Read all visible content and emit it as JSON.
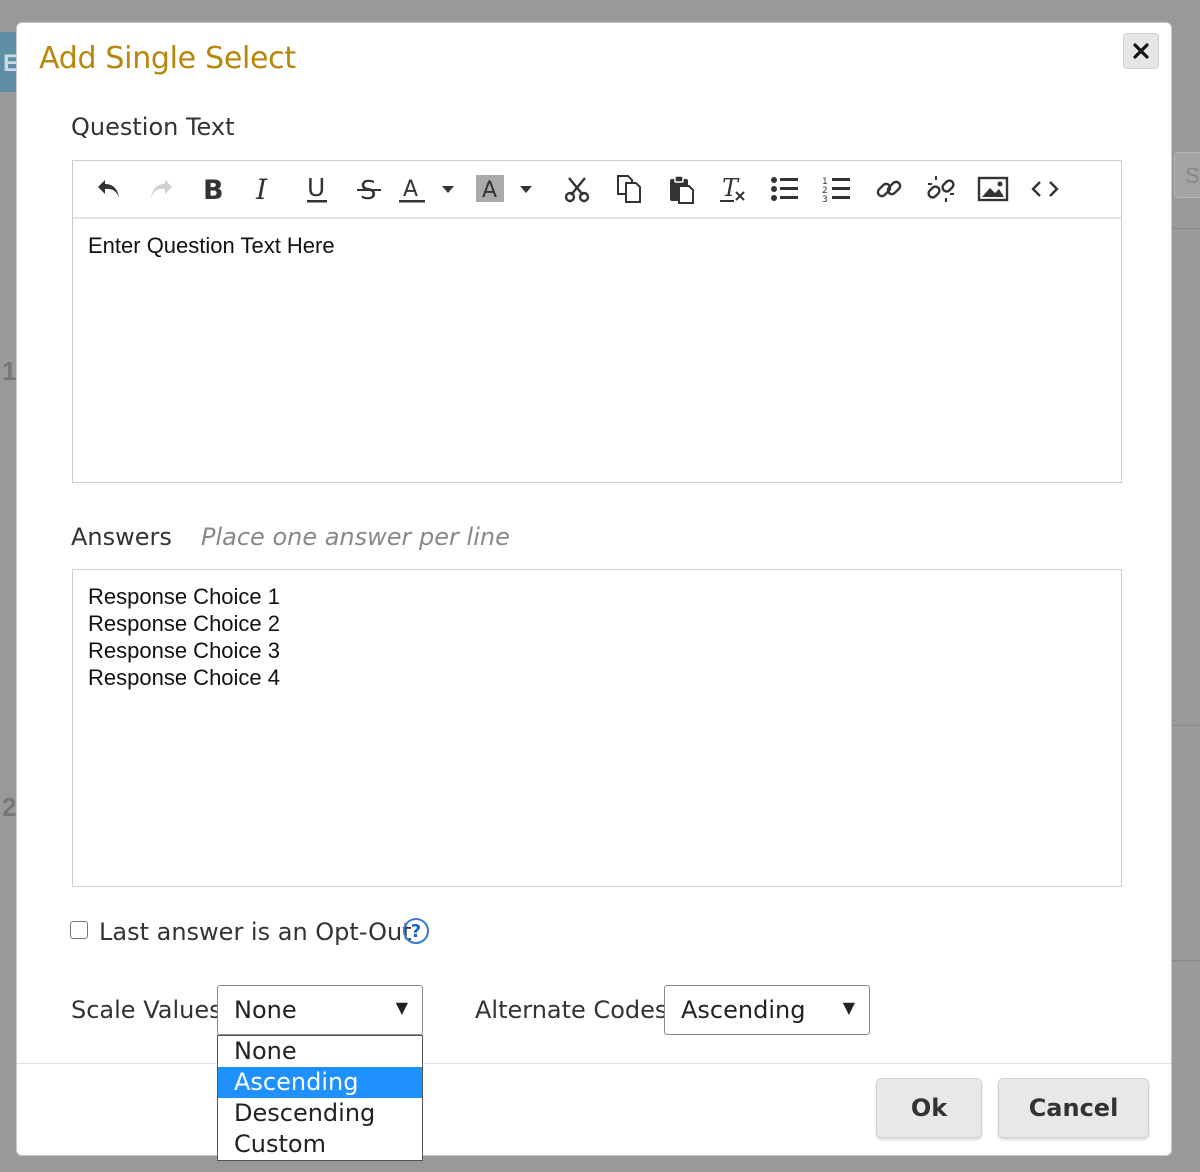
{
  "background": {
    "tab_letter": "E",
    "row_numbers": [
      "1",
      "2"
    ],
    "search_placeholder": "Se"
  },
  "dialog": {
    "title": "Add Single Select",
    "question": {
      "label": "Question Text",
      "body": "Enter Question Text Here",
      "toolbar": [
        "undo-icon",
        "redo-icon",
        "bold-icon",
        "italic-icon",
        "underline-icon",
        "strikethrough-icon",
        "text-color-icon",
        "text-color-dropdown-icon",
        "highlight-color-icon",
        "highlight-dropdown-icon",
        "cut-icon",
        "copy-icon",
        "paste-icon",
        "clear-format-icon",
        "bulleted-list-icon",
        "numbered-list-icon",
        "link-icon",
        "unlink-icon",
        "image-icon",
        "source-code-icon"
      ]
    },
    "answers": {
      "label": "Answers",
      "hint": "Place one answer per line",
      "lines": [
        "Response Choice 1",
        "Response Choice 2",
        "Response Choice 3",
        "Response Choice 4"
      ]
    },
    "opt_out": {
      "label": "Last answer is an Opt-Out",
      "checked": false,
      "help": "?"
    },
    "scale_values": {
      "label": "Scale Values",
      "value": "None",
      "options": [
        "None",
        "Ascending",
        "Descending",
        "Custom"
      ],
      "highlighted": "Ascending"
    },
    "alternate_codes": {
      "label": "Alternate Codes",
      "value": "Ascending"
    },
    "buttons": {
      "ok": "Ok",
      "cancel": "Cancel"
    }
  },
  "colors": {
    "title": "#b8860b",
    "highlight": "#1e90ff",
    "help": "#1a64c8"
  }
}
